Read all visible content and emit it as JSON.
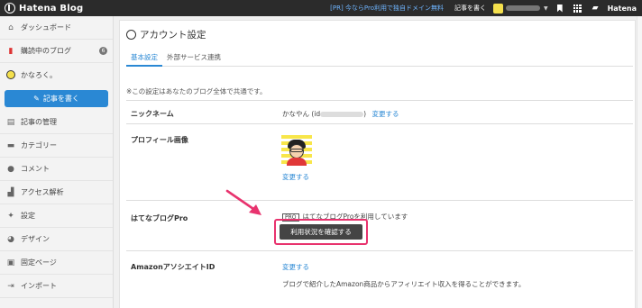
{
  "topbar": {
    "logo": "Hatena Blog",
    "promo": "[PR] 今ならPro利用で独自ドメイン無料",
    "write": "記事を書く",
    "brand": "Hatena"
  },
  "sidebar": {
    "items": [
      {
        "label": "ダッシュボード"
      },
      {
        "label": "購読中のブログ",
        "badge": "6"
      }
    ],
    "user": "かなろく。",
    "write_button": "記事を書く",
    "nav": [
      {
        "label": "記事の管理"
      },
      {
        "label": "カテゴリー"
      },
      {
        "label": "コメント"
      },
      {
        "label": "アクセス解析"
      },
      {
        "label": "設定"
      },
      {
        "label": "デザイン"
      },
      {
        "label": "固定ページ"
      },
      {
        "label": "インポート"
      }
    ]
  },
  "main": {
    "title": "アカウント設定",
    "tabs": [
      {
        "label": "基本設定",
        "active": true
      },
      {
        "label": "外部サービス連携",
        "active": false
      }
    ],
    "note": "※この設定はあなたのブログ全体で共通です。",
    "rows": {
      "nickname": {
        "label": "ニックネーム",
        "value_prefix": "かなやん (id",
        "value_suffix": ")",
        "link": "変更する"
      },
      "profile": {
        "label": "プロフィール画像",
        "link": "変更する"
      },
      "pro": {
        "label": "はてなブログPro",
        "tag": "PRO",
        "status": "はてなブログProを利用しています",
        "button": "利用状況を確認する"
      },
      "amazon": {
        "label": "AmazonアソシエイトID",
        "link": "変更する",
        "desc": "ブログで紹介したAmazon商品からアフィリエイト収入を得ることができます。"
      }
    }
  },
  "colors": {
    "accent": "#2a88d4",
    "highlight": "#e8336e",
    "topbar": "#2b2b2b"
  }
}
